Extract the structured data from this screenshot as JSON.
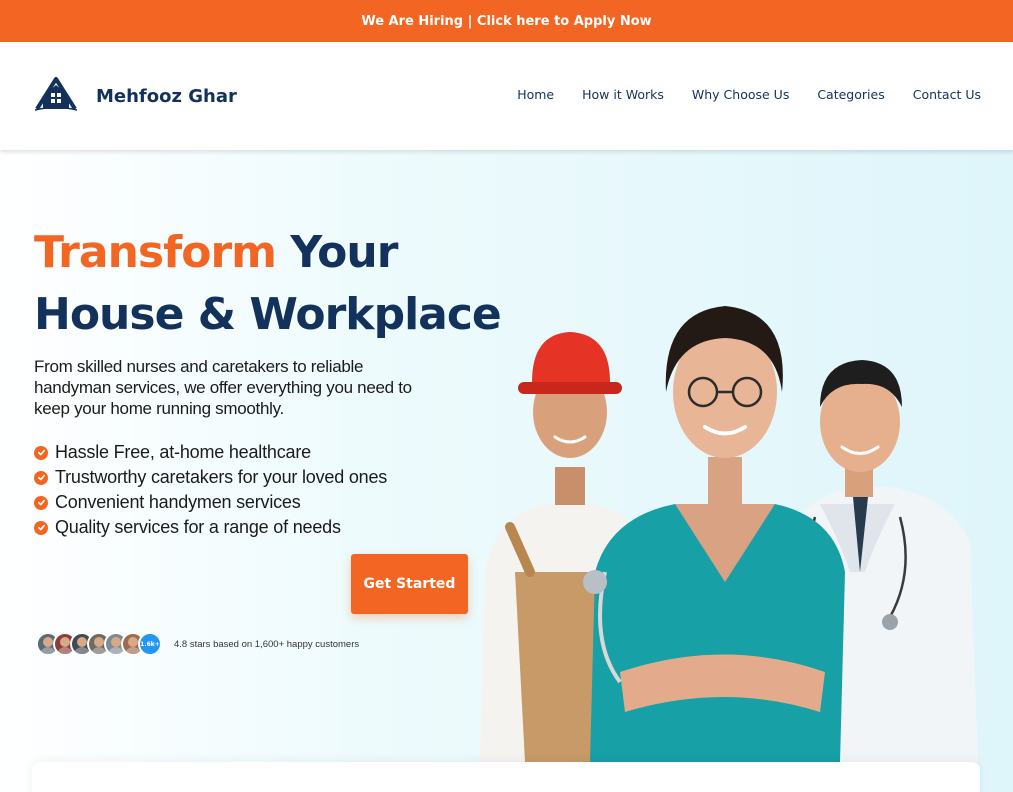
{
  "announcement": {
    "text": "We Are Hiring | Click here to Apply Now"
  },
  "brand": {
    "name": "Mehfooz Ghar"
  },
  "nav": {
    "items": [
      {
        "label": "Home"
      },
      {
        "label": "How it Works"
      },
      {
        "label": "Why Choose Us"
      },
      {
        "label": "Categories"
      },
      {
        "label": "Contact Us"
      }
    ]
  },
  "hero": {
    "headline_accent": "Transform",
    "headline_line1_rest": " Your",
    "headline_line2": "House & Workplace",
    "subtext": "From skilled nurses and caretakers to reliable handyman services, we offer everything you need to keep your home running smoothly.",
    "features": [
      "Hassle Free, at-home healthcare",
      "Trustworthy caretakers for your loved ones",
      "Convenient handymen services",
      "Quality services for a range of needs"
    ],
    "cta_label": "Get Started",
    "social_proof": {
      "avatar_badge": "1.6k+",
      "text": "4.8 stars based on 1,600+ happy customers"
    }
  },
  "colors": {
    "accent": "#f26522",
    "navy": "#13325b",
    "hero_bg": "#def5fa"
  }
}
